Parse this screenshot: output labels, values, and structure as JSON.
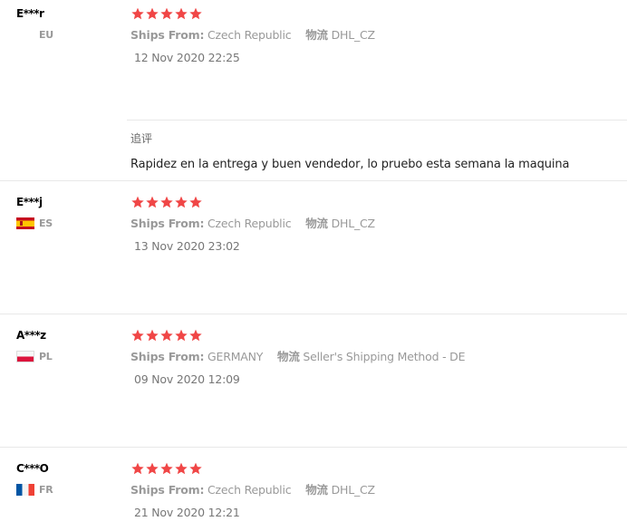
{
  "colors": {
    "star": "#f04646",
    "divider": "#e8e8e8",
    "muted": "#999999"
  },
  "reviews": [
    {
      "user": "E***r",
      "country": "EU",
      "flag_icon": "none",
      "rating": 5,
      "ships_from_label": "Ships From:",
      "ships_from": "Czech Republic",
      "logistics_label": "物流",
      "logistics": "DHL_CZ",
      "date": "12 Nov 2020 22:25",
      "additional": {
        "title": "追评",
        "text": "Rapidez en la entrega y buen vendedor, lo pruebo esta semana la maquina"
      }
    },
    {
      "user": "E***j",
      "country": "ES",
      "flag_icon": "spain-flag-icon",
      "rating": 5,
      "ships_from_label": "Ships From:",
      "ships_from": "Czech Republic",
      "logistics_label": "物流",
      "logistics": "DHL_CZ",
      "date": "13 Nov 2020 23:02"
    },
    {
      "user": "A***z",
      "country": "PL",
      "flag_icon": "poland-flag-icon",
      "rating": 5,
      "ships_from_label": "Ships From:",
      "ships_from": "GERMANY",
      "logistics_label": "物流",
      "logistics": "Seller's Shipping Method - DE",
      "date": "09 Nov 2020 12:09"
    },
    {
      "user": "C***O",
      "country": "FR",
      "flag_icon": "france-flag-icon",
      "rating": 5,
      "ships_from_label": "Ships From:",
      "ships_from": "Czech Republic",
      "logistics_label": "物流",
      "logistics": "DHL_CZ",
      "date": "21 Nov 2020 12:21"
    }
  ]
}
